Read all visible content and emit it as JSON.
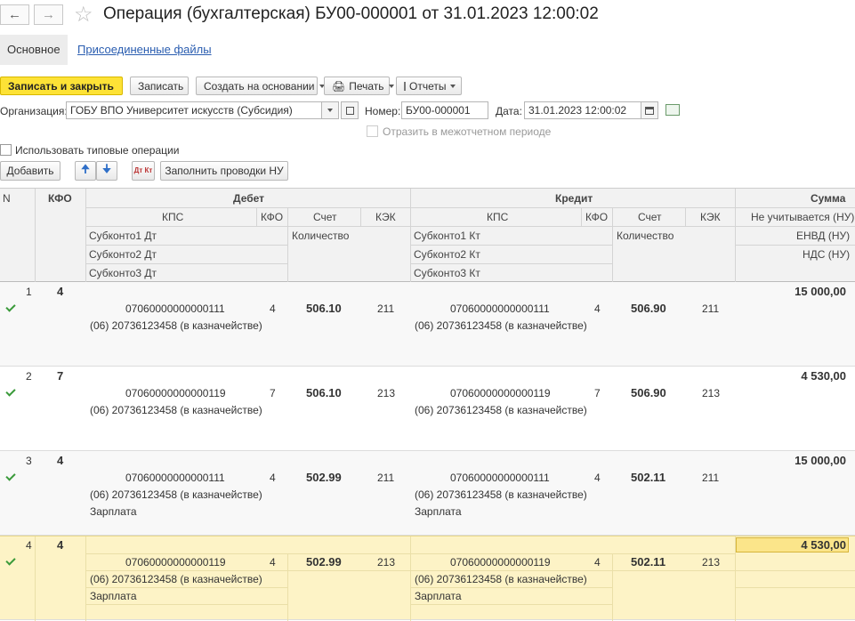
{
  "window": {
    "title": "Операция (бухгалтерская) БУ00-000001 от 31.01.2023 12:00:02"
  },
  "tabs": [
    {
      "label": "Основное"
    },
    {
      "label": "Присоединенные файлы"
    }
  ],
  "toolbar": {
    "save_close": "Записать и закрыть",
    "save": "Записать",
    "create_based": "Создать на основании",
    "print": "Печать",
    "reports": "Отчеты"
  },
  "form": {
    "org_label": "Организация:",
    "org_value": "ГОБУ ВПО Университет искусств (Субсидия)",
    "number_label": "Номер:",
    "number_value": "БУ00-000001",
    "date_label": "Дата:",
    "date_value": "31.01.2023 12:00:02",
    "intercom_label": "Отразить в межотчетном периоде",
    "typical_label": "Использовать типовые операции"
  },
  "table_toolbar": {
    "add": "Добавить",
    "fill": "Заполнить проводки НУ",
    "dtkt": "Дт Кт"
  },
  "header": {
    "n": "N",
    "kfo": "КФО",
    "debit": "Дебет",
    "credit": "Кредит",
    "sum": "Сумма",
    "kps": "КПС",
    "kfo2": "КФО",
    "account": "Счет",
    "kek": "КЭК",
    "not_counted": "Не учитывается (НУ)",
    "qty": "Количество",
    "envd": "ЕНВД (НУ)",
    "nds": "НДС (НУ)",
    "sub1_dt": "Субконто1 Дт",
    "sub2_dt": "Субконто2 Дт",
    "sub3_dt": "Субконто3 Дт",
    "sub1_kt": "Субконто1 Кт",
    "sub2_kt": "Субконто2 Кт",
    "sub3_kt": "Субконто3 Кт"
  },
  "rows": [
    {
      "n": "1",
      "kfo": "4",
      "sum": "15 000,00",
      "dt_kps": "07060000000000111",
      "dt_kfo": "4",
      "dt_acc": "506.10",
      "dt_kek": "211",
      "dt_sub1": "(06) 20736123458 (в казначействе)",
      "dt_sub2": "",
      "kt_kps": "07060000000000111",
      "kt_kfo": "4",
      "kt_acc": "506.90",
      "kt_kek": "211",
      "kt_sub1": "(06) 20736123458 (в казначействе)",
      "kt_sub2": ""
    },
    {
      "n": "2",
      "kfo": "7",
      "sum": "4 530,00",
      "dt_kps": "07060000000000119",
      "dt_kfo": "7",
      "dt_acc": "506.10",
      "dt_kek": "213",
      "dt_sub1": "(06) 20736123458 (в казначействе)",
      "dt_sub2": "",
      "kt_kps": "07060000000000119",
      "kt_kfo": "7",
      "kt_acc": "506.90",
      "kt_kek": "213",
      "kt_sub1": "(06) 20736123458 (в казначействе)",
      "kt_sub2": ""
    },
    {
      "n": "3",
      "kfo": "4",
      "sum": "15 000,00",
      "dt_kps": "07060000000000111",
      "dt_kfo": "4",
      "dt_acc": "502.99",
      "dt_kek": "211",
      "dt_sub1": "(06) 20736123458 (в казначействе)",
      "dt_sub2": "Зарплата",
      "kt_kps": "07060000000000111",
      "kt_kfo": "4",
      "kt_acc": "502.11",
      "kt_kek": "211",
      "kt_sub1": "(06) 20736123458 (в казначействе)",
      "kt_sub2": "Зарплата"
    },
    {
      "n": "4",
      "kfo": "4",
      "sum": "4 530,00",
      "dt_kps": "07060000000000119",
      "dt_kfo": "4",
      "dt_acc": "502.99",
      "dt_kek": "213",
      "dt_sub1": "(06) 20736123458 (в казначействе)",
      "dt_sub2": "Зарплата",
      "kt_kps": "07060000000000119",
      "kt_kfo": "4",
      "kt_acc": "502.11",
      "kt_kek": "213",
      "kt_sub1": "(06) 20736123458 (в казначействе)",
      "kt_sub2": "Зарплата"
    }
  ],
  "colors": {
    "accent": "#fde236",
    "selected_row": "#fdf3c6",
    "check": "#3a9a3a"
  }
}
